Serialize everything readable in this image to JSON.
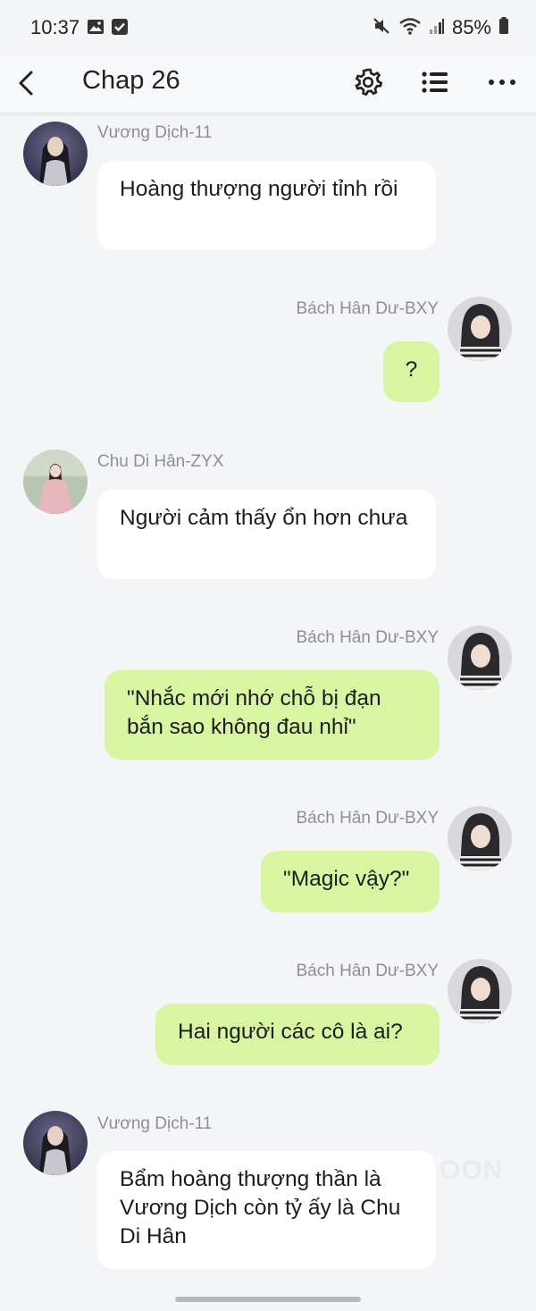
{
  "status_bar": {
    "time": "10:37",
    "battery": "85%"
  },
  "header": {
    "title": "Chap 26"
  },
  "messages": [
    {
      "side": "left",
      "sender": "Vương Dịch-11",
      "text": "Hoàng thượng người tỉnh rồi",
      "avatar": "vuong-dich"
    },
    {
      "side": "right",
      "sender": "Bách Hân Dư-BXY",
      "text": "?",
      "avatar": "bach-han-du"
    },
    {
      "side": "left",
      "sender": "Chu Di Hân-ZYX",
      "text": "Người cảm thấy ổn hơn chưa",
      "avatar": "chu-di-han"
    },
    {
      "side": "right",
      "sender": "Bách Hân Dư-BXY",
      "text": "\"Nhắc mới nhớ chỗ bị đạn bắn sao không đau nhỉ\"",
      "avatar": "bach-han-du"
    },
    {
      "side": "right",
      "sender": "Bách Hân Dư-BXY",
      "text": "\"Magic vậy?\"",
      "avatar": "bach-han-du"
    },
    {
      "side": "right",
      "sender": "Bách Hân Dư-BXY",
      "text": "Hai người các cô là ai?",
      "avatar": "bach-han-du"
    },
    {
      "side": "left",
      "sender": "Vương Dịch-11",
      "text": "Bẩm hoàng thượng thần là Vương Dịch còn tỷ ấy là Chu Di Hân",
      "avatar": "vuong-dich"
    }
  ],
  "watermark": "OON",
  "colors": {
    "background": "#f4f5f7",
    "bubble_left": "#ffffff",
    "bubble_right": "#d8f5a2",
    "sender_text": "#8f8f93"
  }
}
